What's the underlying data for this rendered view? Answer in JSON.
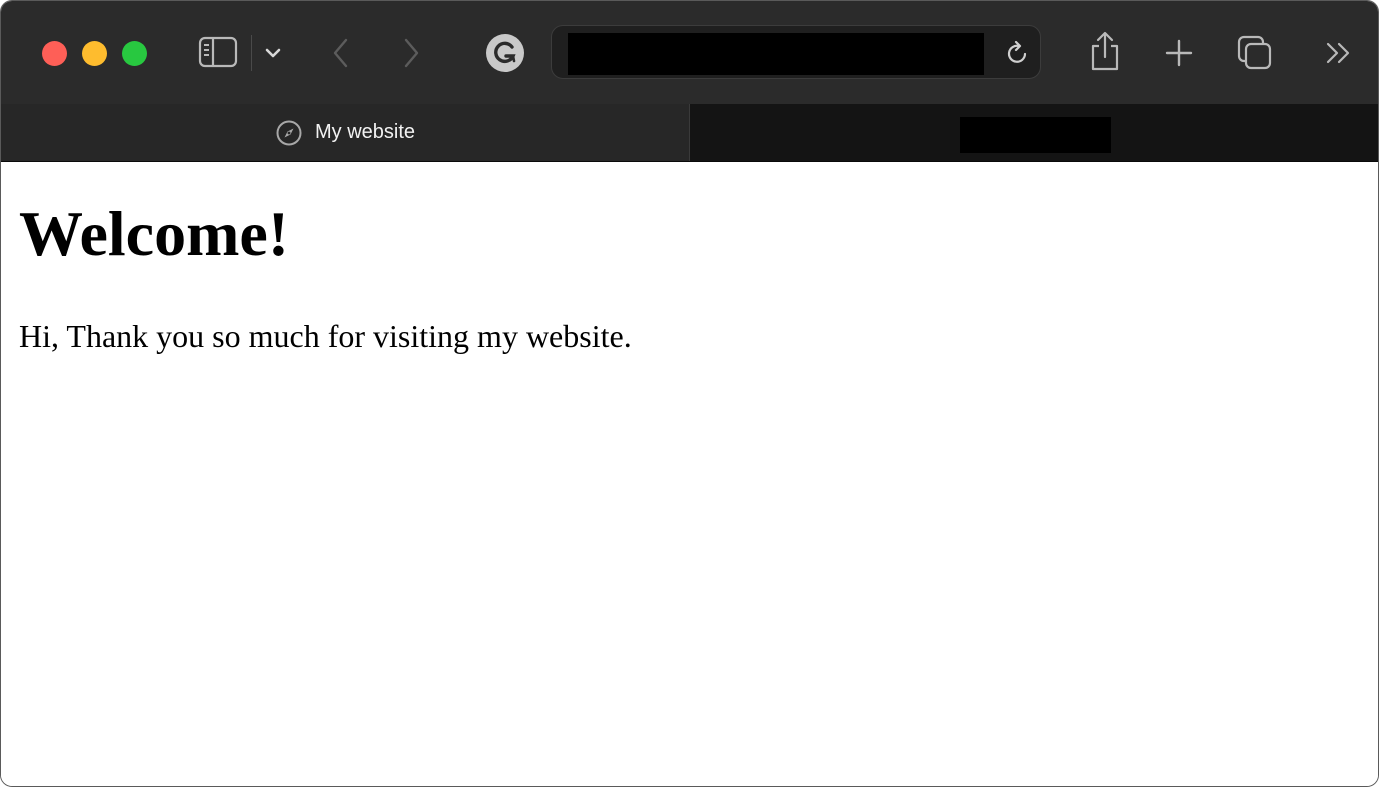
{
  "browser": {
    "window_controls": [
      "close",
      "minimize",
      "maximize"
    ],
    "toolbar": {
      "icons": {
        "sidebar": "sidebar-icon",
        "sidebar_menu": "chevron-down-icon",
        "back": "chevron-left-icon",
        "forward": "chevron-right-icon",
        "extension": "grammarly-icon",
        "reload": "reload-icon",
        "share": "share-icon",
        "new_tab": "plus-icon",
        "tab_overview": "tab-overview-icon",
        "more": "double-chevron-right-icon"
      }
    },
    "address_bar": {
      "url_redacted": true
    },
    "tabs": [
      {
        "title": "My website",
        "icon": "compass-icon",
        "active": true
      },
      {
        "title_redacted": true,
        "active": false
      }
    ]
  },
  "page": {
    "heading": "Welcome!",
    "paragraph": "Hi, Thank you so much for visiting my website."
  },
  "colors": {
    "close": "#fe5f57",
    "minimize": "#febc2e",
    "maximize": "#28c840",
    "toolbar_bg": "#2b2b2b"
  }
}
